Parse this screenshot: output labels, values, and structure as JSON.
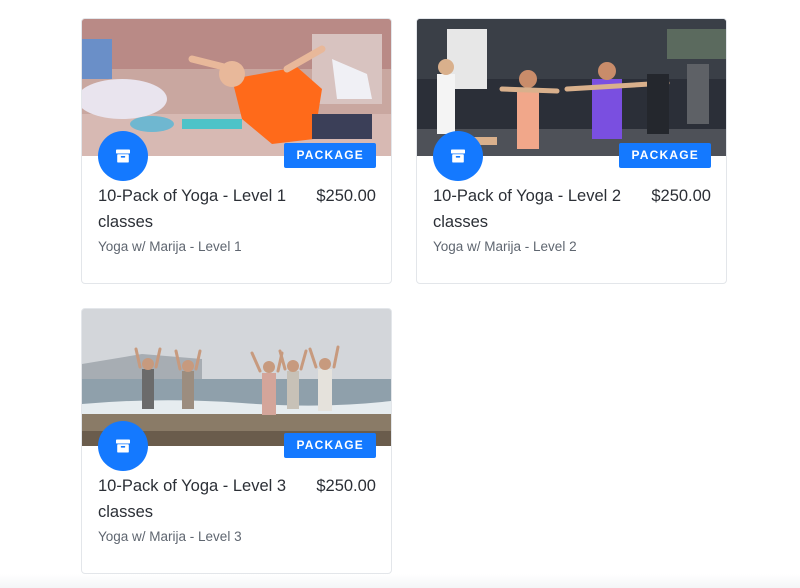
{
  "cards": [
    {
      "badge": "PACKAGE",
      "title": "10-Pack of Yoga - Level 1 classes",
      "price": "$250.00",
      "subtitle": "Yoga w/ Marija - Level 1",
      "icon": "archive-icon",
      "image": "yoga-class-studio-photo"
    },
    {
      "badge": "PACKAGE",
      "title": "10-Pack of Yoga - Level 2 classes",
      "price": "$250.00",
      "subtitle": "Yoga w/ Marija - Level 2",
      "icon": "archive-icon",
      "image": "yoga-class-warrior-pose-photo"
    },
    {
      "badge": "PACKAGE",
      "title": "10-Pack of Yoga - Level 3 classes",
      "price": "$250.00",
      "subtitle": "Yoga w/ Marija - Level 3",
      "icon": "archive-icon",
      "image": "yoga-beach-tree-pose-photo"
    }
  ],
  "colors": {
    "accent": "#1479ff",
    "text": "#2b2f36",
    "muted": "#5f6670",
    "border": "#e3e6ea"
  }
}
